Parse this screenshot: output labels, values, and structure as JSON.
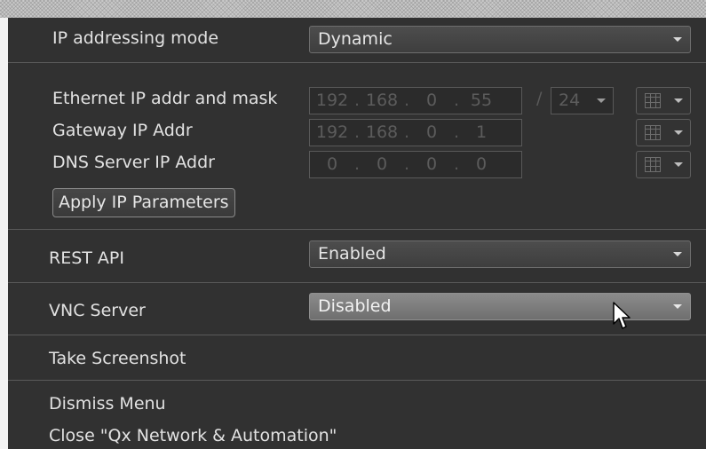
{
  "network": {
    "ip_mode_label": "IP addressing mode",
    "ip_mode_value": "Dynamic",
    "ethernet_label": "Ethernet IP addr and mask",
    "ethernet_ip": [
      "192",
      "168",
      "0",
      "55"
    ],
    "mask_separator": "/",
    "mask_value": "24",
    "gateway_label": "Gateway IP Addr",
    "gateway_ip": [
      "192",
      "168",
      "0",
      "1"
    ],
    "dns_label": "DNS Server IP Addr",
    "dns_ip": [
      "0",
      "0",
      "0",
      "0"
    ],
    "octet_separator": ".",
    "apply_label": "Apply IP Parameters"
  },
  "rest_api": {
    "label": "REST API",
    "value": "Enabled"
  },
  "vnc": {
    "label": "VNC Server",
    "value": "Disabled"
  },
  "actions": {
    "screenshot": "Take Screenshot",
    "dismiss": "Dismiss Menu",
    "close": "Close \"Qx Network & Automation\""
  },
  "icons": {
    "dropdown": "chevron-down-icon",
    "keypad": "keypad-icon",
    "cursor": "mouse-cursor-icon"
  },
  "colors": {
    "panel_bg": "#313131",
    "highlight": "#7d7d7d",
    "disabled_text": "#5c5c5c"
  }
}
